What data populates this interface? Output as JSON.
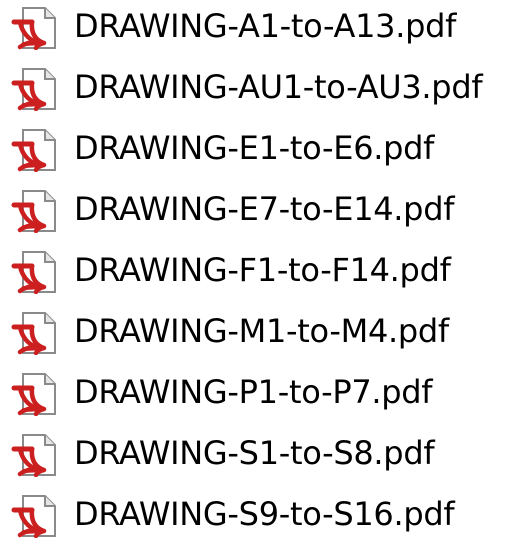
{
  "colors": {
    "pdf_red": "#cc1f1f",
    "page_fill": "#ffffff",
    "page_border": "#8a8a8a",
    "text": "#000000"
  },
  "files": [
    {
      "name": "DRAWING-A1-to-A13.pdf",
      "icon": "pdf-file-icon"
    },
    {
      "name": "DRAWING-AU1-to-AU3.pdf",
      "icon": "pdf-file-icon"
    },
    {
      "name": "DRAWING-E1-to-E6.pdf",
      "icon": "pdf-file-icon"
    },
    {
      "name": "DRAWING-E7-to-E14.pdf",
      "icon": "pdf-file-icon"
    },
    {
      "name": "DRAWING-F1-to-F14.pdf",
      "icon": "pdf-file-icon"
    },
    {
      "name": "DRAWING-M1-to-M4.pdf",
      "icon": "pdf-file-icon"
    },
    {
      "name": "DRAWING-P1-to-P7.pdf",
      "icon": "pdf-file-icon"
    },
    {
      "name": "DRAWING-S1-to-S8.pdf",
      "icon": "pdf-file-icon"
    },
    {
      "name": "DRAWING-S9-to-S16.pdf",
      "icon": "pdf-file-icon"
    }
  ]
}
